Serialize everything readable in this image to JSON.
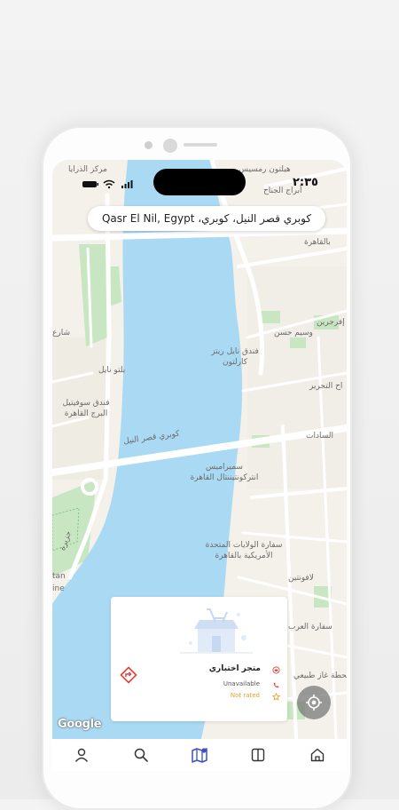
{
  "status_bar": {
    "time": "٢:٣٥"
  },
  "search": {
    "location": "كوبري قصر النيل، كوبري، Qasr El Nil, Egypt"
  },
  "map": {
    "labels": {
      "hilton": "هيلتون رمسيس",
      "ramses_towers": "أبراج الجناح",
      "cairo_top": "بالقاهرة",
      "maspero": "مركز الذرايا",
      "kasr_nile_top": "شارع",
      "nile_ritz": "فندق نايل ريتز كارلتون",
      "evergreen": "إفرجرين",
      "waseem_hassan": "وسيم حسن",
      "tahrir": "اح التحرير",
      "sofitel": "فندق سوفيتيل البرج القاهرة",
      "belt_nile": "بلتو نايل",
      "bridge": "كوبري قصر النيل",
      "sadat": "السادات",
      "semiramis": "سميراميس انتركونتيننتال القاهرة",
      "us_embassy": "سفارة الولايات المتحدة الأمريكية بالقاهرة",
      "kasr_dobara": "لافونتين",
      "gas": "محطة غاز طبيعي",
      "embassy_right": "سفارة العرب",
      "gezira": "جزيرة",
      "tan": "tan",
      "ine": "ine"
    }
  },
  "store_card": {
    "name": "متجر اختباري",
    "status": "Unavailable",
    "rating": "Not rated"
  },
  "google_logo": "Google",
  "colors": {
    "river": "#aadaf3",
    "land": "#f4f1ea",
    "park": "#c8e6c1",
    "road": "#ffffff",
    "accent_red": "#e0443a",
    "nav_active": "#3b4fc7",
    "rating": "#e8a02c"
  },
  "nav": {
    "items": [
      {
        "icon": "person-icon"
      },
      {
        "icon": "search-icon"
      },
      {
        "icon": "map-icon"
      },
      {
        "icon": "book-icon"
      },
      {
        "icon": "home-icon"
      }
    ]
  }
}
